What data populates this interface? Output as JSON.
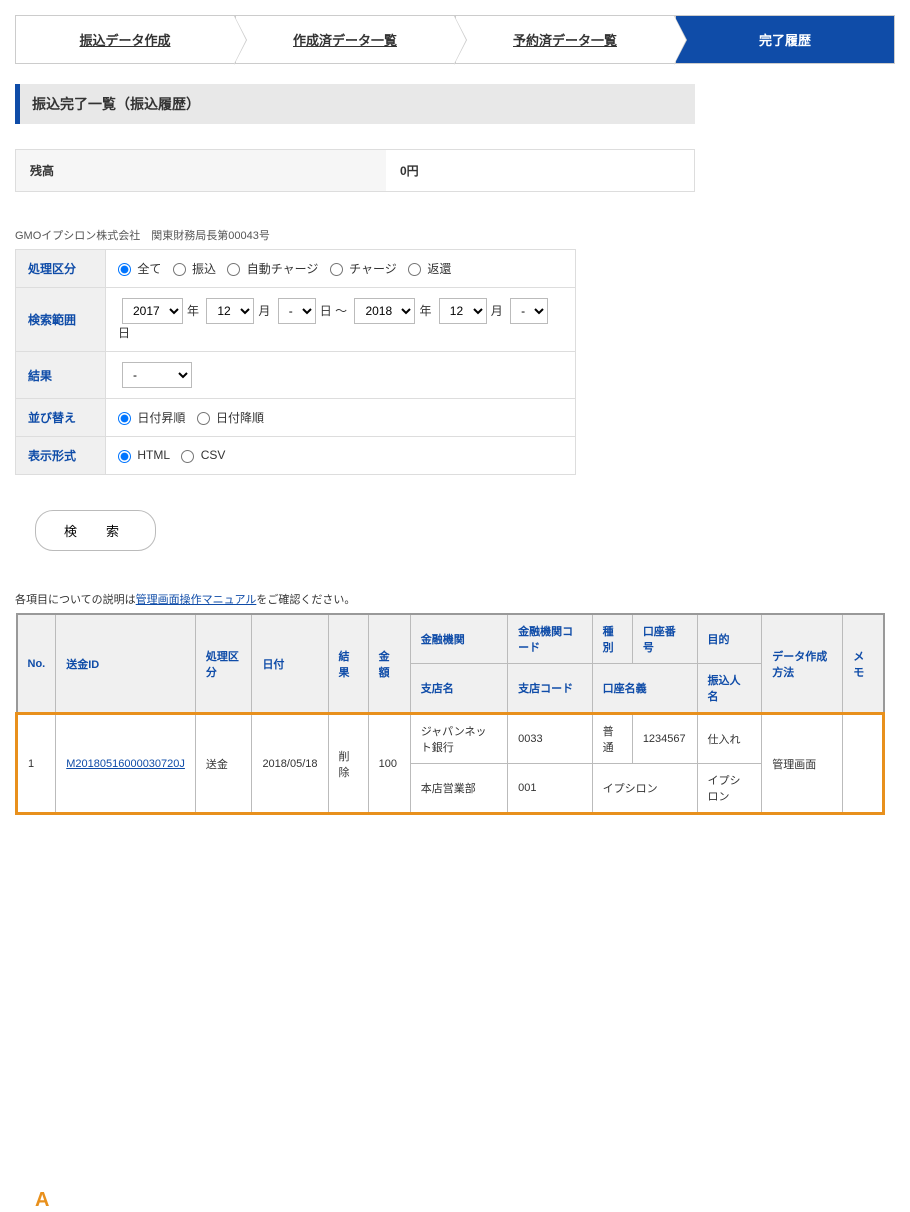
{
  "tabs": [
    {
      "label": "振込データ作成",
      "active": false
    },
    {
      "label": "作成済データ一覧",
      "active": false
    },
    {
      "label": "予約済データ一覧",
      "active": false
    },
    {
      "label": "完了履歴",
      "active": true
    }
  ],
  "section_title": "振込完了一覧（振込履歴）",
  "balance": {
    "label": "残高",
    "value": "0円"
  },
  "company_info": "GMOイプシロン株式会社　関東財務局長第00043号",
  "filters": {
    "process_type": {
      "label": "処理区分",
      "options": [
        "全て",
        "振込",
        "自動チャージ",
        "チャージ",
        "返還"
      ]
    },
    "search_range": {
      "label": "検索範囲",
      "from_year": "2017",
      "from_month": "12",
      "from_day": "-",
      "to_year": "2018",
      "to_month": "12",
      "to_day": "-",
      "unit_year": "年",
      "unit_month": "月",
      "unit_day": "日",
      "range_sep": "～"
    },
    "result": {
      "label": "結果",
      "value": "-"
    },
    "sort": {
      "label": "並び替え",
      "options": [
        "日付昇順",
        "日付降順"
      ]
    },
    "format": {
      "label": "表示形式",
      "options": [
        "HTML",
        "CSV"
      ]
    }
  },
  "search_button": "検　索",
  "note_prefix": "各項目についての説明は",
  "note_link": "管理画面操作マニュアル",
  "note_suffix": "をご確認ください。",
  "annotation": "A",
  "table": {
    "headers": {
      "no": "No.",
      "id": "送金ID",
      "process": "処理区分",
      "date": "日付",
      "result": "結果",
      "amount": "金額",
      "bank": "金融機関",
      "bank_code": "金融機関コード",
      "type": "種別",
      "account_no": "口座番号",
      "purpose": "目的",
      "branch": "支店名",
      "branch_code": "支店コード",
      "account_name": "口座名義",
      "transfer_name": "振込人名",
      "method": "データ作成方法",
      "memo": "メモ"
    },
    "rows": [
      {
        "no": "1",
        "id": "M20180516000030720J",
        "process": "送金",
        "date": "2018/05/18",
        "result": "削除",
        "amount": "100",
        "bank": "ジャパンネット銀行",
        "bank_code": "0033",
        "type": "普通",
        "account_no": "1234567",
        "purpose": "仕入れ",
        "branch": "本店営業部",
        "branch_code": "001",
        "account_name": "イプシロン",
        "transfer_name": "イプシロン",
        "method": "管理画面",
        "memo": ""
      }
    ]
  }
}
